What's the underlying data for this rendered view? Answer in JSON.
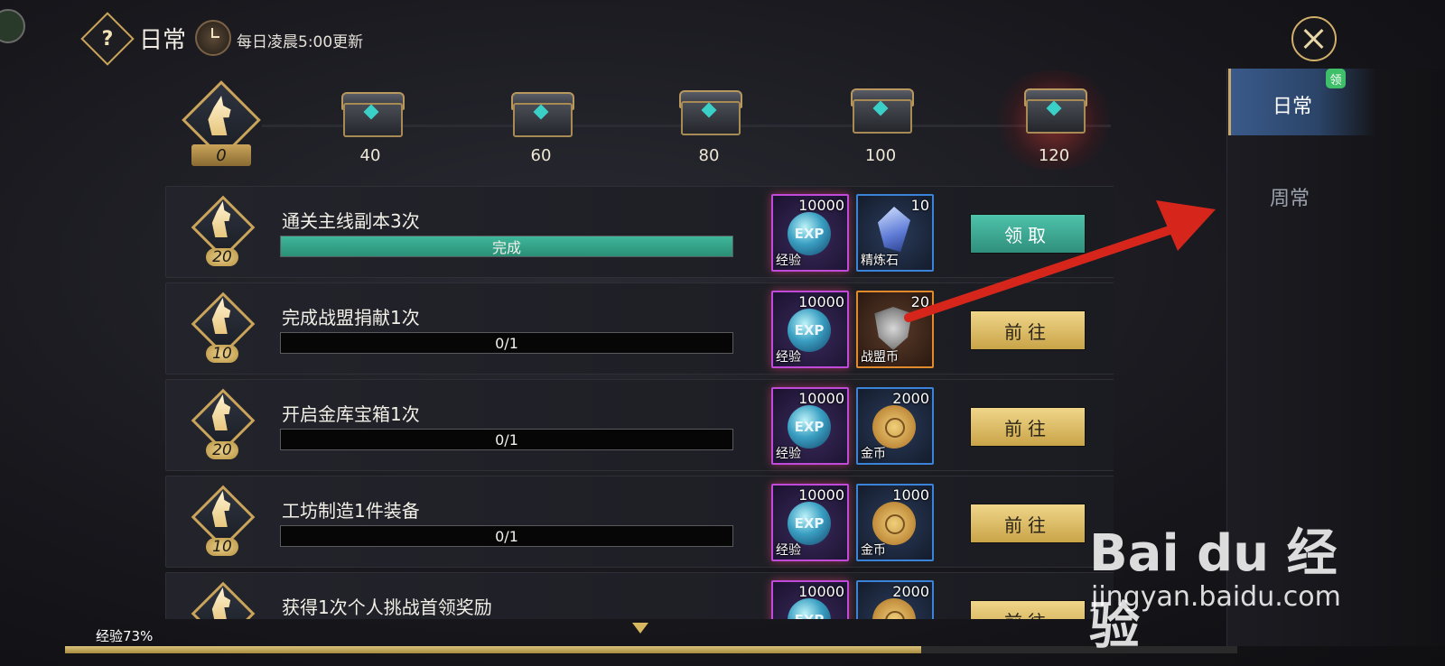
{
  "header": {
    "help_icon_text": "?",
    "title": "日常",
    "refresh_note": "每日凌晨5:00更新"
  },
  "tabs": {
    "daily": "日常",
    "weekly": "周常",
    "daily_badge": "领"
  },
  "activity": {
    "current": "0",
    "milestones": [
      "40",
      "60",
      "80",
      "100",
      "120"
    ]
  },
  "tasks": [
    {
      "points": "20",
      "name": "通关主线副本3次",
      "progress_text": "完成",
      "progress": 1.0,
      "exp_count": "10000",
      "exp_name": "经验",
      "exp_icon": "EXP",
      "item_count": "10",
      "item_name": "精炼石",
      "button": "领取"
    },
    {
      "points": "10",
      "name": "完成战盟捐献1次",
      "progress_text": "0/1",
      "progress": 0,
      "exp_count": "10000",
      "exp_name": "经验",
      "exp_icon": "EXP",
      "item_count": "20",
      "item_name": "战盟币",
      "button": "前往"
    },
    {
      "points": "20",
      "name": "开启金库宝箱1次",
      "progress_text": "0/1",
      "progress": 0,
      "exp_count": "10000",
      "exp_name": "经验",
      "exp_icon": "EXP",
      "item_count": "2000",
      "item_name": "金币",
      "button": "前往"
    },
    {
      "points": "10",
      "name": "工坊制造1件装备",
      "progress_text": "0/1",
      "progress": 0,
      "exp_count": "10000",
      "exp_name": "经验",
      "exp_icon": "EXP",
      "item_count": "1000",
      "item_name": "金币",
      "button": "前往"
    },
    {
      "points": "",
      "name": "获得1次个人挑战首领奖励",
      "progress_text": "",
      "progress": 0,
      "exp_count": "10000",
      "exp_name": "",
      "exp_icon": "EXP",
      "item_count": "2000",
      "item_name": "",
      "button": "前往"
    }
  ],
  "footer": {
    "exp_label": "经验73%",
    "exp_progress": 0.73
  },
  "watermark": {
    "logo": "Bai du 经验",
    "url": "jingyan.baidu.com"
  },
  "colors": {
    "accent_gold": "#c9a45a",
    "claim_green": "#3fb79a",
    "tab_blue": "#3a5a8a",
    "annotation_red": "#d6261c"
  }
}
